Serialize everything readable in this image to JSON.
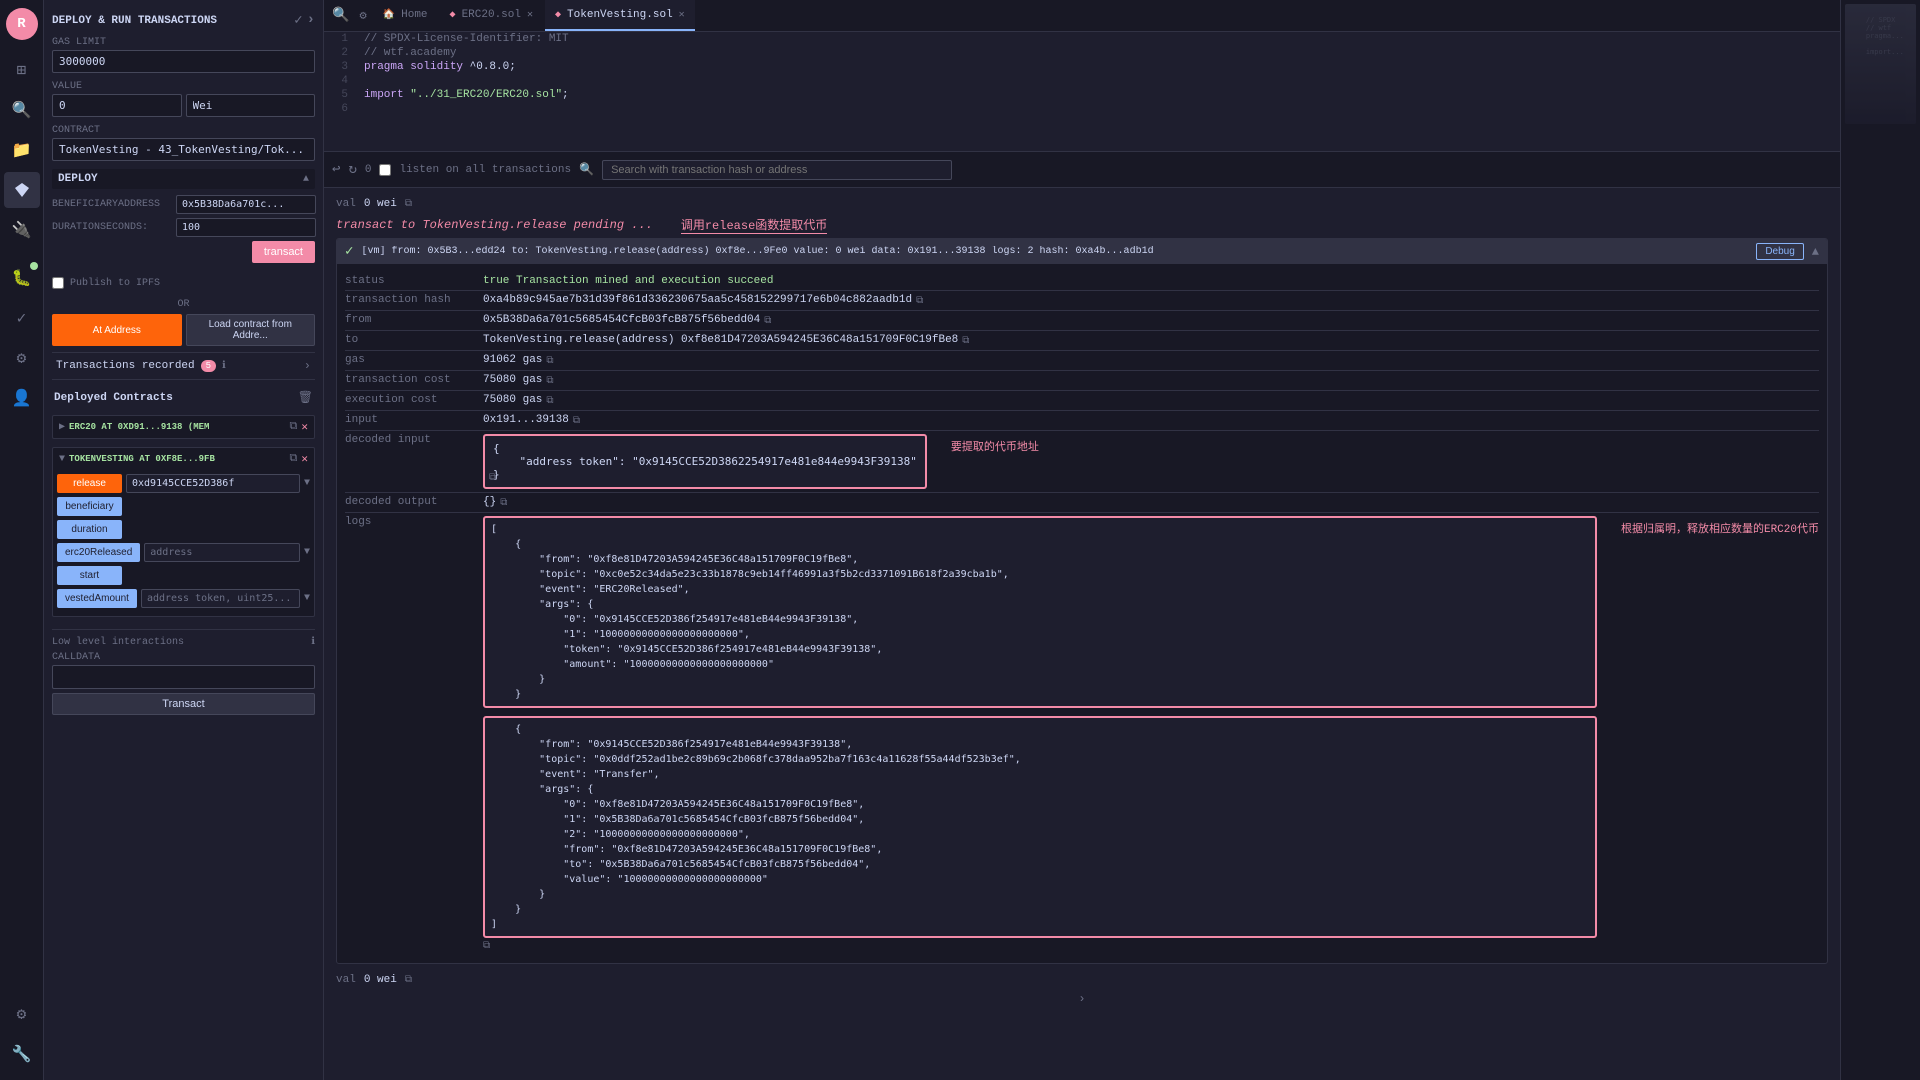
{
  "app": {
    "title": "DEPLOY & RUN TRANSACTIONS"
  },
  "sidebar": {
    "brand": "R",
    "icons": [
      "⊞",
      "🔍",
      "📁",
      "⚙",
      "🔧",
      "👤"
    ],
    "bottom_icons": [
      "⚙",
      "🔧"
    ]
  },
  "gas_limit": {
    "label": "GAS LIMIT",
    "value": "3000000"
  },
  "value_field": {
    "label": "VALUE",
    "value": "0",
    "unit": "Wei"
  },
  "contract_field": {
    "label": "CONTRACT",
    "value": "TokenVesting - 43_TokenVesting/Tok..."
  },
  "deploy_section": {
    "label": "DEPLOY",
    "params": {
      "beneficiary_label": "BENEFICIARYADDRESS",
      "beneficiary_value": "0x5B38Da6a701c...",
      "duration_label": "DURATIONSECONDS:",
      "duration_value": "100"
    },
    "transact_label": "transact"
  },
  "publish_ipfs": {
    "label": "Publish to IPFS"
  },
  "or_text": "OR",
  "at_address_label": "At Address",
  "load_contract_label": "Load contract from Addre...",
  "transactions": {
    "label": "Transactions recorded",
    "count": "5",
    "expand_icon": ">"
  },
  "deployed_contracts": {
    "label": "Deployed Contracts",
    "contracts": [
      {
        "id": "erc20",
        "name": "ERC20 AT 0XD91...9138 (MEM",
        "expanded": false,
        "toggle": "▶"
      },
      {
        "id": "tokenvesting",
        "name": "TOKENVESTING AT 0XF8E...9FB",
        "expanded": true,
        "toggle": "▼",
        "methods": [
          {
            "type": "orange",
            "label": "release",
            "input": "0xd9145CCE52D386f",
            "has_dropdown": true
          },
          {
            "type": "blue",
            "label": "beneficiary",
            "input": "",
            "has_dropdown": false
          },
          {
            "type": "blue",
            "label": "duration",
            "input": "",
            "has_dropdown": false
          },
          {
            "type": "blue",
            "label": "erc20Released",
            "select": "address",
            "has_dropdown": true
          },
          {
            "type": "blue",
            "label": "start",
            "input": "",
            "has_dropdown": false
          },
          {
            "type": "blue",
            "label": "vestedAmount",
            "select": "address token, uint25...",
            "has_dropdown": true
          }
        ]
      }
    ]
  },
  "low_level": {
    "label": "Low level interactions",
    "calldata_label": "CALLDATA",
    "calldata_value": "",
    "transact_label": "Transact"
  },
  "tabs": {
    "search_icon": "🔍",
    "items": [
      {
        "id": "home",
        "label": "Home",
        "icon": "🏠",
        "active": false,
        "closable": false
      },
      {
        "id": "erc20",
        "label": "ERC20.sol",
        "icon": "◆",
        "active": false,
        "closable": true
      },
      {
        "id": "tokenvesting",
        "label": "TokenVesting.sol",
        "icon": "◆",
        "active": true,
        "closable": true
      }
    ]
  },
  "code_lines": [
    {
      "num": 1,
      "code": "// SPDX-License-Identifier: MIT",
      "type": "comment"
    },
    {
      "num": 2,
      "code": "// wtf.academy",
      "type": "comment"
    },
    {
      "num": 3,
      "code": "pragma solidity ^0.8.0;",
      "type": "pragma"
    },
    {
      "num": 4,
      "code": "",
      "type": "normal"
    },
    {
      "num": 5,
      "code": "import \"../31_ERC20/ERC20.sol\";",
      "type": "import"
    },
    {
      "num": 6,
      "code": "",
      "type": "normal"
    }
  ],
  "tx_toolbar": {
    "counter": "0",
    "listen_label": "listen on all transactions",
    "search_placeholder": "Search with transaction hash or address"
  },
  "tx_output": {
    "val_label": "val",
    "val_value": "0 wei",
    "pending_text": "transact to TokenVesting.release pending ...",
    "pending_annotation": "调用release函数提取代币",
    "tx_block": {
      "prefix": "[vm]",
      "from_short": "from: 0x5B3...edd24",
      "to_short": "to: TokenVesting.release(address) 0xf8e...9Fe0",
      "value_short": "value: 0 wei",
      "data_short": "data: 0x191...39138",
      "logs_short": "logs: 2",
      "hash_short": "hash: 0xa4b...adb1d",
      "debug_label": "Debug",
      "status_label": "status",
      "status_value": "true Transaction mined and execution succeed",
      "tx_hash_label": "transaction hash",
      "tx_hash_value": "0xa4b89c945ae7b31d39f861d336230675aa5c458152299717e6b04c882aadb1d",
      "from_label": "from",
      "from_value": "0x5B38Da6a701c5685454CfcB03fcB875f56bedd04",
      "to_label": "to",
      "to_value": "TokenVesting.release(address) 0xf8e81D47203A594245E36C48a151709F0C19fBe8",
      "gas_label": "gas",
      "gas_value": "91062 gas",
      "tx_cost_label": "transaction cost",
      "tx_cost_value": "75080 gas",
      "exec_cost_label": "execution cost",
      "exec_cost_value": "75080 gas",
      "input_label": "input",
      "input_value": "0x191...39138",
      "decoded_input_label": "decoded input",
      "decoded_input_value": "{\n    \"address token\": \"0x9145CCE52D3862254917e481e844e9943F39138\"\n}",
      "decoded_input_annotation": "要提取的代币地址",
      "decoded_output_label": "decoded output",
      "decoded_output_value": "{} ",
      "logs_label": "logs",
      "logs_value": "[\n    {\n        \"from\": \"0xf8e81D47203A594245E36C48a151709F0C19fBe8\",\n        \"topic\": \"0xc0e52c34da5e23c33b1878c9eb14ff46991a3f5b2cd3371091B618f2a39cba1b\",\n        \"event\": \"ERC20Released\",\n        \"args\": {\n            \"0\": \"0x9145CCE52D386f254917e481eB44e9943F39138\",\n            \"1\": \"10000000000000000000000\",\n            \"token\": \"0x9145CCE52D386f254917e481eB44e9943F39138\",\n            \"amount\": \"10000000000000000000000\"\n        }\n    },\n    {\n        \"from\": \"0x9145CCE52D386f254917e481eB44e9943F39138\",\n        \"topic\": \"0x0ddf252ad1be2c89b69c2b068fc378daa952ba7f163c4a11628f55a44df523b3ef\",\n        \"event\": \"Transfer\",\n        \"args\": {\n            \"0\": \"0xf8e81D47203A594245E36C48a151709F0C19fBe8\",\n            \"1\": \"0x5B38Da6a701c5685454CfcB03fcB875f56bedd04\",\n            \"2\": \"10000000000000000000000\",\n            \"from\": \"0xf8e81D47203A594245E36C48a151709F0C19fBe8\",\n            \"to\": \"0x5B38Da6a701c5685454CfcB03fcB875f56bedd04\",\n            \"value\": \"10000000000000000000000\"\n        }\n    }\n]",
      "logs_annotation": "根据归属明，释放相应数量的ERC20代币",
      "val2_label": "val",
      "val2_value": "0 wei"
    }
  },
  "colors": {
    "accent_orange": "#fe640b",
    "accent_blue": "#89b4fa",
    "accent_green": "#a6e3a1",
    "accent_red": "#f38ba8",
    "bg_dark": "#181825",
    "bg_main": "#1e1e2e",
    "border": "#313244"
  }
}
